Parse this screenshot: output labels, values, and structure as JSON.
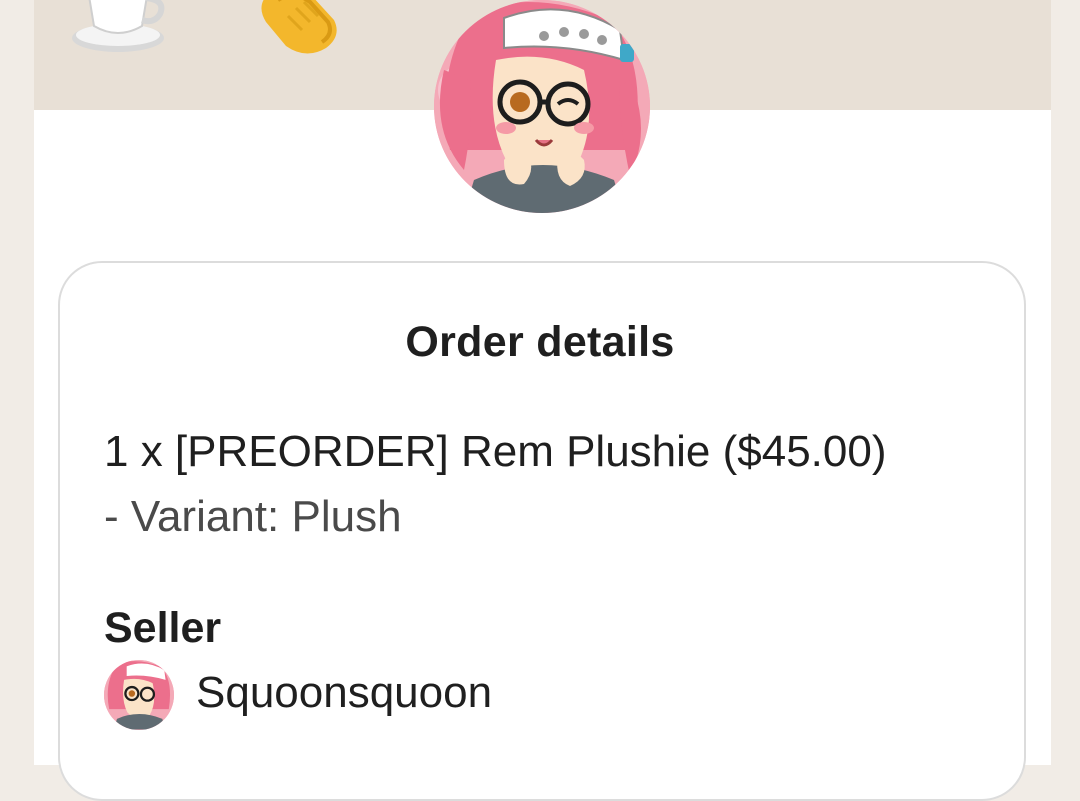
{
  "banner": {
    "background": "#e8e0d6",
    "icons": [
      "coffee-cup-icon",
      "clapping-hands-icon"
    ]
  },
  "profile": {
    "avatar": "seller-avatar-illustration",
    "accent": "#f3a6b6"
  },
  "order_card": {
    "title": "Order details",
    "item_text": "1 x [PREORDER] Rem Plushie ($45.00)",
    "variant_text": "- Variant: Plush",
    "seller_heading": "Seller",
    "seller_name": "Squoonsquoon"
  }
}
